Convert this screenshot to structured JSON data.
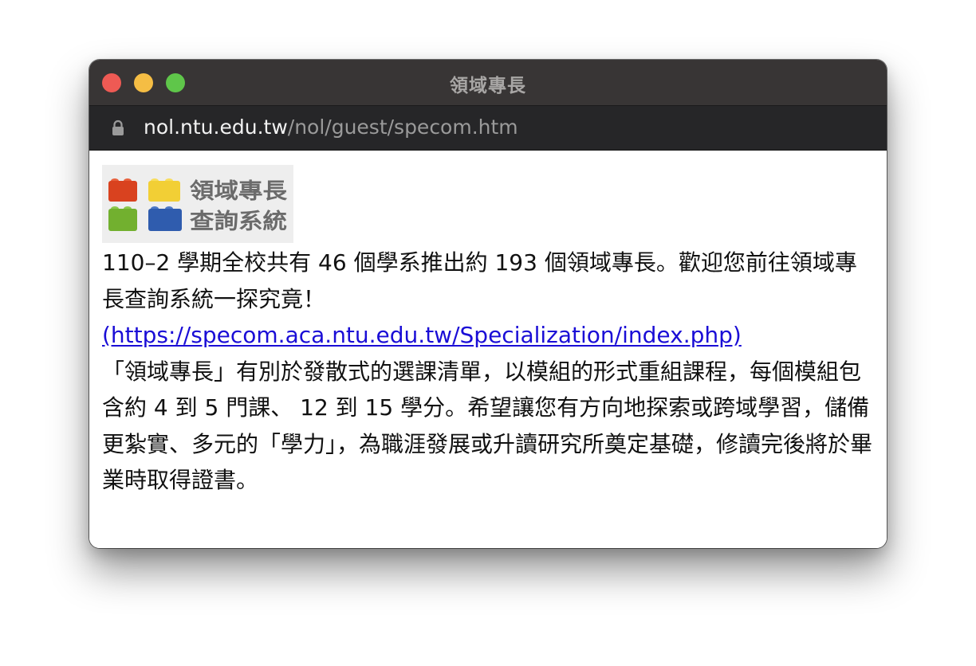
{
  "window": {
    "title": "領域專長"
  },
  "address_bar": {
    "host": "nol.ntu.edu.tw",
    "path": "/nol/guest/specom.htm"
  },
  "logo": {
    "line1": "領域專長",
    "line2": "查詢系統",
    "block_colors": [
      "#d9421f",
      "#f2cf35",
      "#72b02f",
      "#2f5cae"
    ]
  },
  "content": {
    "intro": "110–2 學期全校共有 46 個學系推出約 193 個領域專長。歡迎您前往領域專長查詢系統一探究竟！",
    "link_text": "(https://specom.aca.ntu.edu.tw/Specialization/index.php)",
    "description": "「領域專長」有別於發散式的選課清單，以模組的形式重組課程，每個模組包含約 4 到 5 門課、 12 到 15 學分。希望讓您有方向地探索或跨域學習，儲備更紮實、多元的「學力」，為職涯發展或升讀研究所奠定基礎，修讀完後將於畢業時取得證書。"
  },
  "colors": {
    "titlebar": "#383535",
    "address_bar": "#262628",
    "link": "#1a0dd6"
  }
}
